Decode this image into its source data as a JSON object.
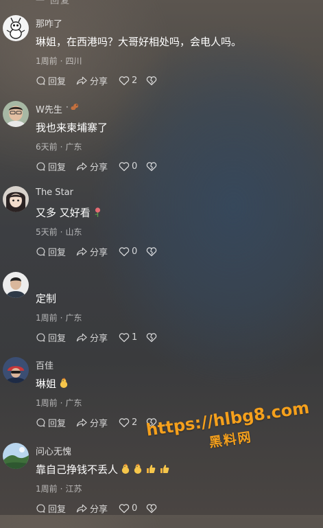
{
  "top_fragment": "一 回复",
  "comments": [
    {
      "username": "那咋了",
      "badge": "",
      "text": "琳姐，在西港吗？大哥好相处吗，会电人吗。",
      "emojis": [],
      "time": "1周前",
      "location": "四川",
      "reply_label": "回复",
      "share_label": "分享",
      "likes": "2",
      "avatar": "ant-cartoon"
    },
    {
      "username": "W先生",
      "badge": "·",
      "text": "我也来柬埔寨了",
      "emojis": [],
      "time": "6天前",
      "location": "广东",
      "reply_label": "回复",
      "share_label": "分享",
      "likes": "0",
      "avatar": "man-photo"
    },
    {
      "username": "The Star",
      "badge": "",
      "text": "又多 又好看",
      "emojis": [
        "rose"
      ],
      "time": "5天前",
      "location": "山东",
      "reply_label": "回复",
      "share_label": "分享",
      "likes": "0",
      "avatar": "girl-cartoon"
    },
    {
      "username": "",
      "badge": "",
      "text": "定制",
      "emojis": [],
      "time": "1周前",
      "location": "广东",
      "reply_label": "回复",
      "share_label": "分享",
      "likes": "1",
      "avatar": "man-white-bg"
    },
    {
      "username": "百佳",
      "badge": "",
      "text": "琳姐",
      "emojis": [
        "chick"
      ],
      "time": "1周前",
      "location": "广东",
      "reply_label": "回复",
      "share_label": "分享",
      "likes": "2",
      "avatar": "rider-photo"
    },
    {
      "username": "问心无愧",
      "badge": "",
      "text": "靠自己挣钱不丢人",
      "emojis": [
        "chick",
        "chick",
        "thumbs-up",
        "thumbs-up"
      ],
      "time": "1周前",
      "location": "江苏",
      "reply_label": "回复",
      "share_label": "分享",
      "likes": "0",
      "avatar": "landscape-photo"
    }
  ],
  "watermark": {
    "url": "https://hlbg8.com",
    "name": "黑料网",
    "color": "#f5a01c"
  },
  "icons": {
    "reply": "reply-bubble-icon",
    "share": "share-arrow-icon",
    "like": "heart-icon",
    "dislike": "broken-heart-icon"
  }
}
